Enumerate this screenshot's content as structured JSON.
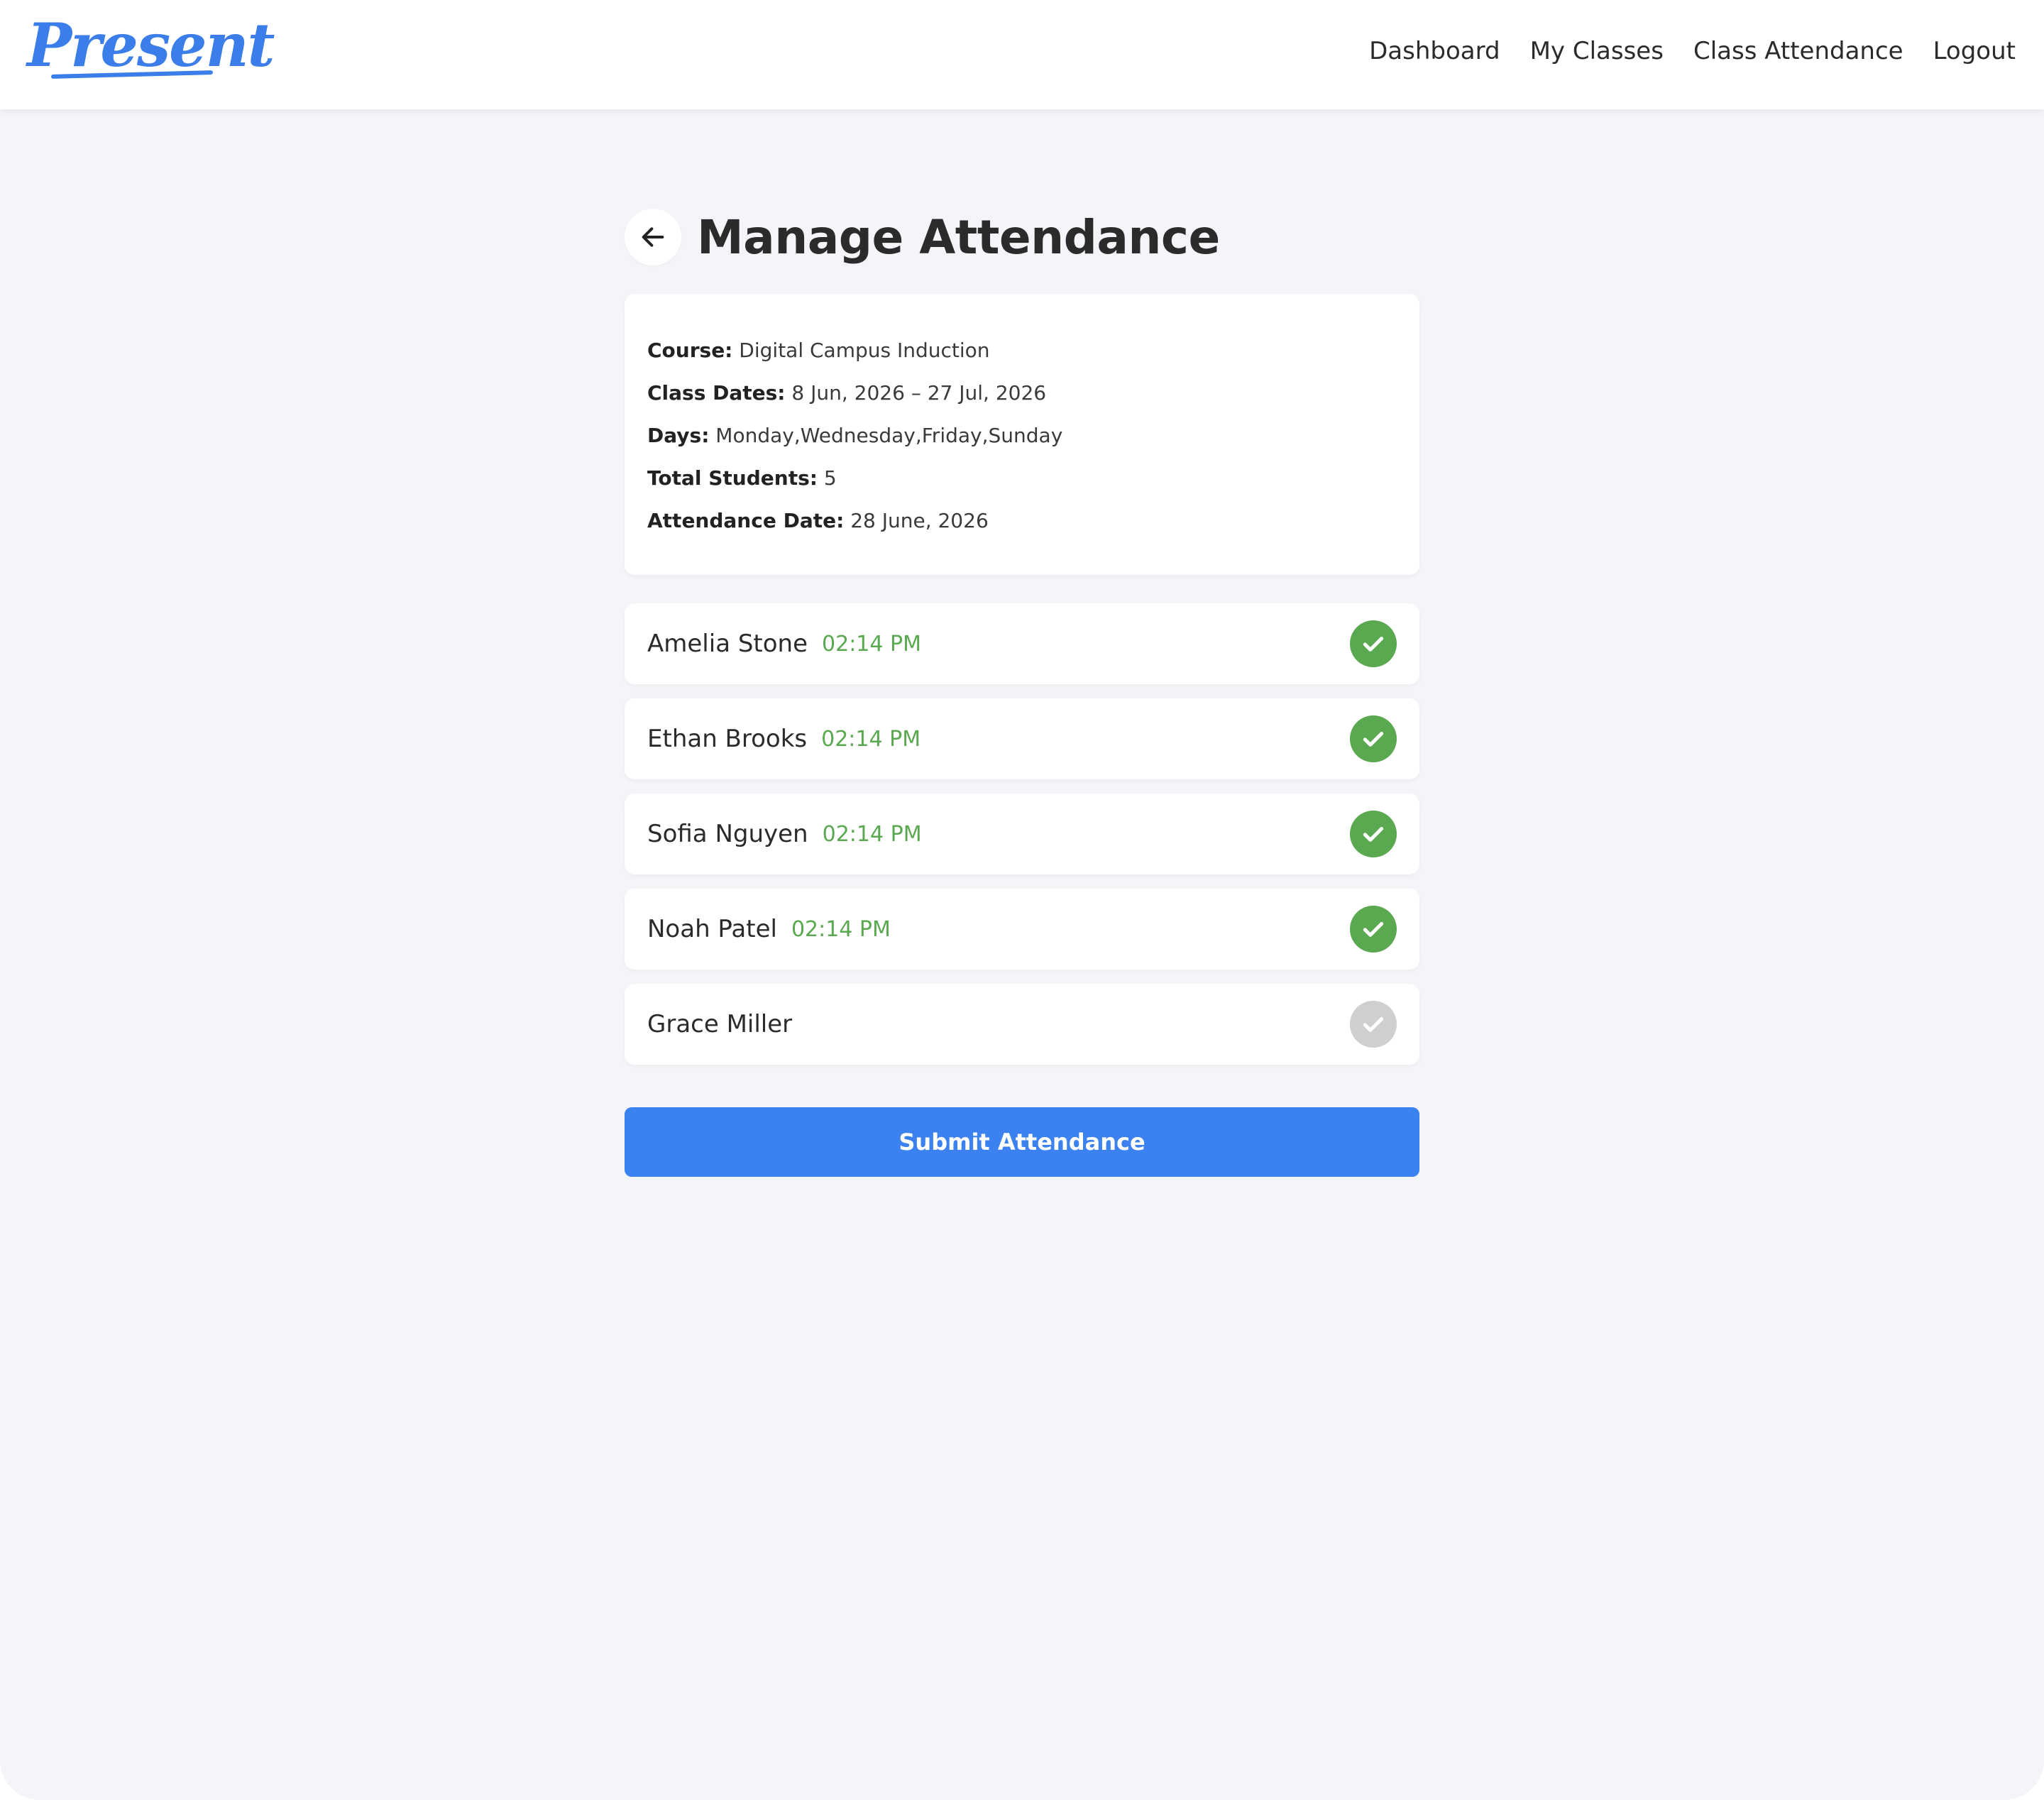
{
  "brand": {
    "logo_text": "Present"
  },
  "nav": {
    "items": [
      {
        "label": "Dashboard"
      },
      {
        "label": "My Classes"
      },
      {
        "label": "Class Attendance"
      },
      {
        "label": "Logout"
      }
    ]
  },
  "page": {
    "title": "Manage Attendance"
  },
  "class_info": {
    "course_label": "Course:",
    "course": "Digital Campus Induction",
    "dates_label": "Class Dates:",
    "dates": "8 Jun, 2026 – 27 Jul, 2026",
    "days_label": "Days:",
    "days": "Monday,Wednesday,Friday,Sunday",
    "total_label": "Total Students:",
    "total": "5",
    "attendance_label": "Attendance Date:",
    "attendance_date": "28 June, 2026"
  },
  "students": [
    {
      "name": "Amelia Stone",
      "time": "02:14 PM",
      "present": true
    },
    {
      "name": "Ethan Brooks",
      "time": "02:14 PM",
      "present": true
    },
    {
      "name": "Sofia Nguyen",
      "time": "02:14 PM",
      "present": true
    },
    {
      "name": "Noah Patel",
      "time": "02:14 PM",
      "present": true
    },
    {
      "name": "Grace Miller",
      "time": "",
      "present": false
    }
  ],
  "actions": {
    "submit_label": "Submit Attendance"
  },
  "colors": {
    "brand": "#3b7ee9",
    "present": "#5aa84f",
    "absent": "#cfcfcf",
    "submit": "#3b82f0",
    "background": "#f4f5f9"
  },
  "icons": {
    "back": "arrow-left-icon",
    "present": "check-circle-icon",
    "absent": "check-circle-icon"
  }
}
